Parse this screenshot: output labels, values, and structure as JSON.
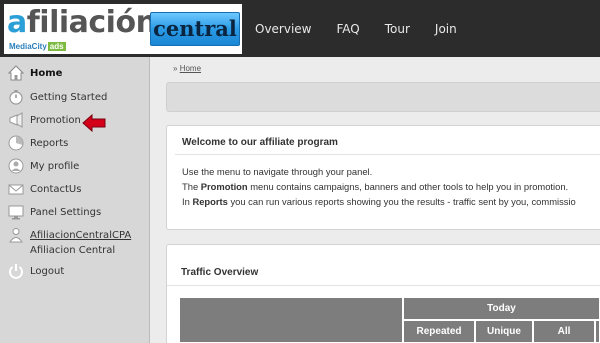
{
  "logo": {
    "word_first": "a",
    "word_rest": "filiación",
    "sub_text": "MediaCity",
    "sub_ads": "ads",
    "badge": "central"
  },
  "topnav": [
    "Overview",
    "FAQ",
    "Tour",
    "Join"
  ],
  "sidebar": {
    "items": [
      {
        "label": "Home",
        "icon": "home-icon"
      },
      {
        "label": "Getting Started",
        "icon": "stopwatch-icon"
      },
      {
        "label": "Promotion",
        "icon": "megaphone-icon"
      },
      {
        "label": "Reports",
        "icon": "pie-chart-icon"
      },
      {
        "label": "My profile",
        "icon": "user-icon"
      },
      {
        "label": "ContactUs",
        "icon": "mail-icon"
      },
      {
        "label": "Panel Settings",
        "icon": "monitor-icon"
      },
      {
        "label": "AfiliacionCentralCPA",
        "icon": "person-icon"
      },
      {
        "label": "Afiliacion Central",
        "icon": ""
      },
      {
        "label": "Logout",
        "icon": "power-icon"
      }
    ]
  },
  "breadcrumb": {
    "sep": "»",
    "home": "Home"
  },
  "welcome": {
    "title": "Welcome to our affiliate program",
    "line1": "Use the menu to navigate through your panel.",
    "line2_pre": "The ",
    "line2_bold": "Promotion",
    "line2_post": " menu contains campaigns, banners and other tools to help you in promotion.",
    "line3_pre": "In ",
    "line3_bold": "Reports",
    "line3_post": " you can run various reports showing you the results - traffic sent by you, commissio"
  },
  "traffic": {
    "title": "Traffic Overview",
    "group": "Today",
    "columns": [
      "Repeated",
      "Unique",
      "All"
    ]
  },
  "colors": {
    "topbar": "#2c2c2c",
    "sidebar": "#d7d7d7",
    "table_header": "#7d7d7d",
    "arrow": "#d4001a",
    "logo_blue": "#1f74b3"
  }
}
